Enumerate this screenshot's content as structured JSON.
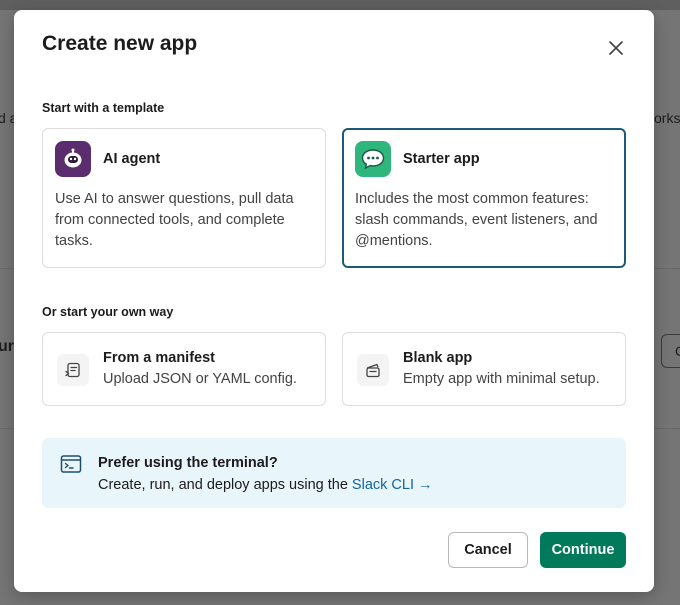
{
  "background": {
    "frag_left_1": "d a",
    "frag_right_1": "orksp",
    "frag_left_2": "ur",
    "frag_btn": "C"
  },
  "modal": {
    "title": "Create new app",
    "close_icon": "close-icon"
  },
  "template_section": {
    "label": "Start with a template",
    "cards": [
      {
        "title": "AI agent",
        "description": "Use AI to answer questions, pull data from connected tools, and complete tasks.",
        "icon": "robot-icon",
        "icon_color": "#5c2d6e",
        "selected": false
      },
      {
        "title": "Starter app",
        "description": "Includes the most common features: slash commands, event listeners, and @mentions.",
        "icon": "chat-bubble-icon",
        "icon_color": "#2eb67d",
        "selected": true
      }
    ]
  },
  "own_section": {
    "label": "Or start your own way",
    "cards": [
      {
        "title": "From a manifest",
        "description": "Upload JSON or YAML config.",
        "icon": "manifest-icon"
      },
      {
        "title": "Blank app",
        "description": "Empty app with minimal setup.",
        "icon": "blank-app-icon"
      }
    ]
  },
  "terminal": {
    "title": "Prefer using the terminal?",
    "description": "Create, run, and deploy apps using the ",
    "link_text": "Slack CLI",
    "link_arrow": "→",
    "icon": "terminal-icon"
  },
  "footer": {
    "cancel_label": "Cancel",
    "continue_label": "Continue"
  },
  "colors": {
    "primary_button": "#007a5a",
    "link": "#1264a3",
    "selected_border": "#1d5a7a",
    "terminal_bg": "#e8f5fa"
  }
}
